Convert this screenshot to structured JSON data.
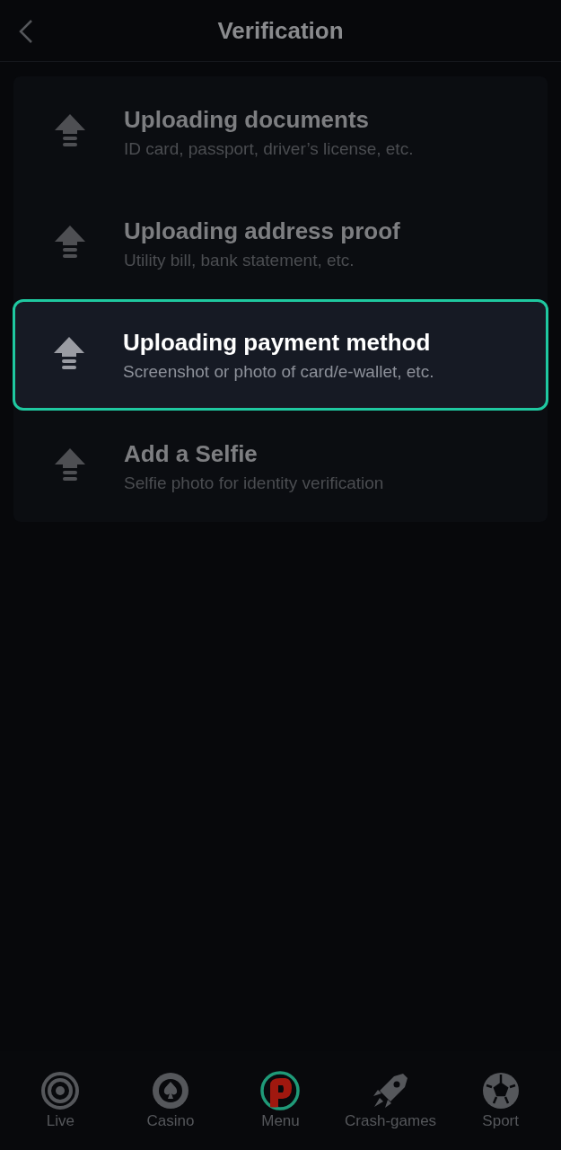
{
  "header": {
    "title": "Verification"
  },
  "items": [
    {
      "title": "Uploading documents",
      "subtitle": "ID card, passport, driver’s license, etc.",
      "selected": false
    },
    {
      "title": "Uploading address proof",
      "subtitle": "Utility bill, bank statement, etc.",
      "selected": false
    },
    {
      "title": "Uploading payment method",
      "subtitle": "Screenshot or photo of card/e-wallet, etc.",
      "selected": true
    },
    {
      "title": "Add a Selfie",
      "subtitle": "Selfie photo for identity verification",
      "selected": false
    }
  ],
  "nav": [
    {
      "kind": "live",
      "label": "Live"
    },
    {
      "kind": "casino",
      "label": "Casino"
    },
    {
      "kind": "menu",
      "label": "Menu"
    },
    {
      "kind": "crash",
      "label": "Crash-games"
    },
    {
      "kind": "sport",
      "label": "Sport"
    }
  ]
}
